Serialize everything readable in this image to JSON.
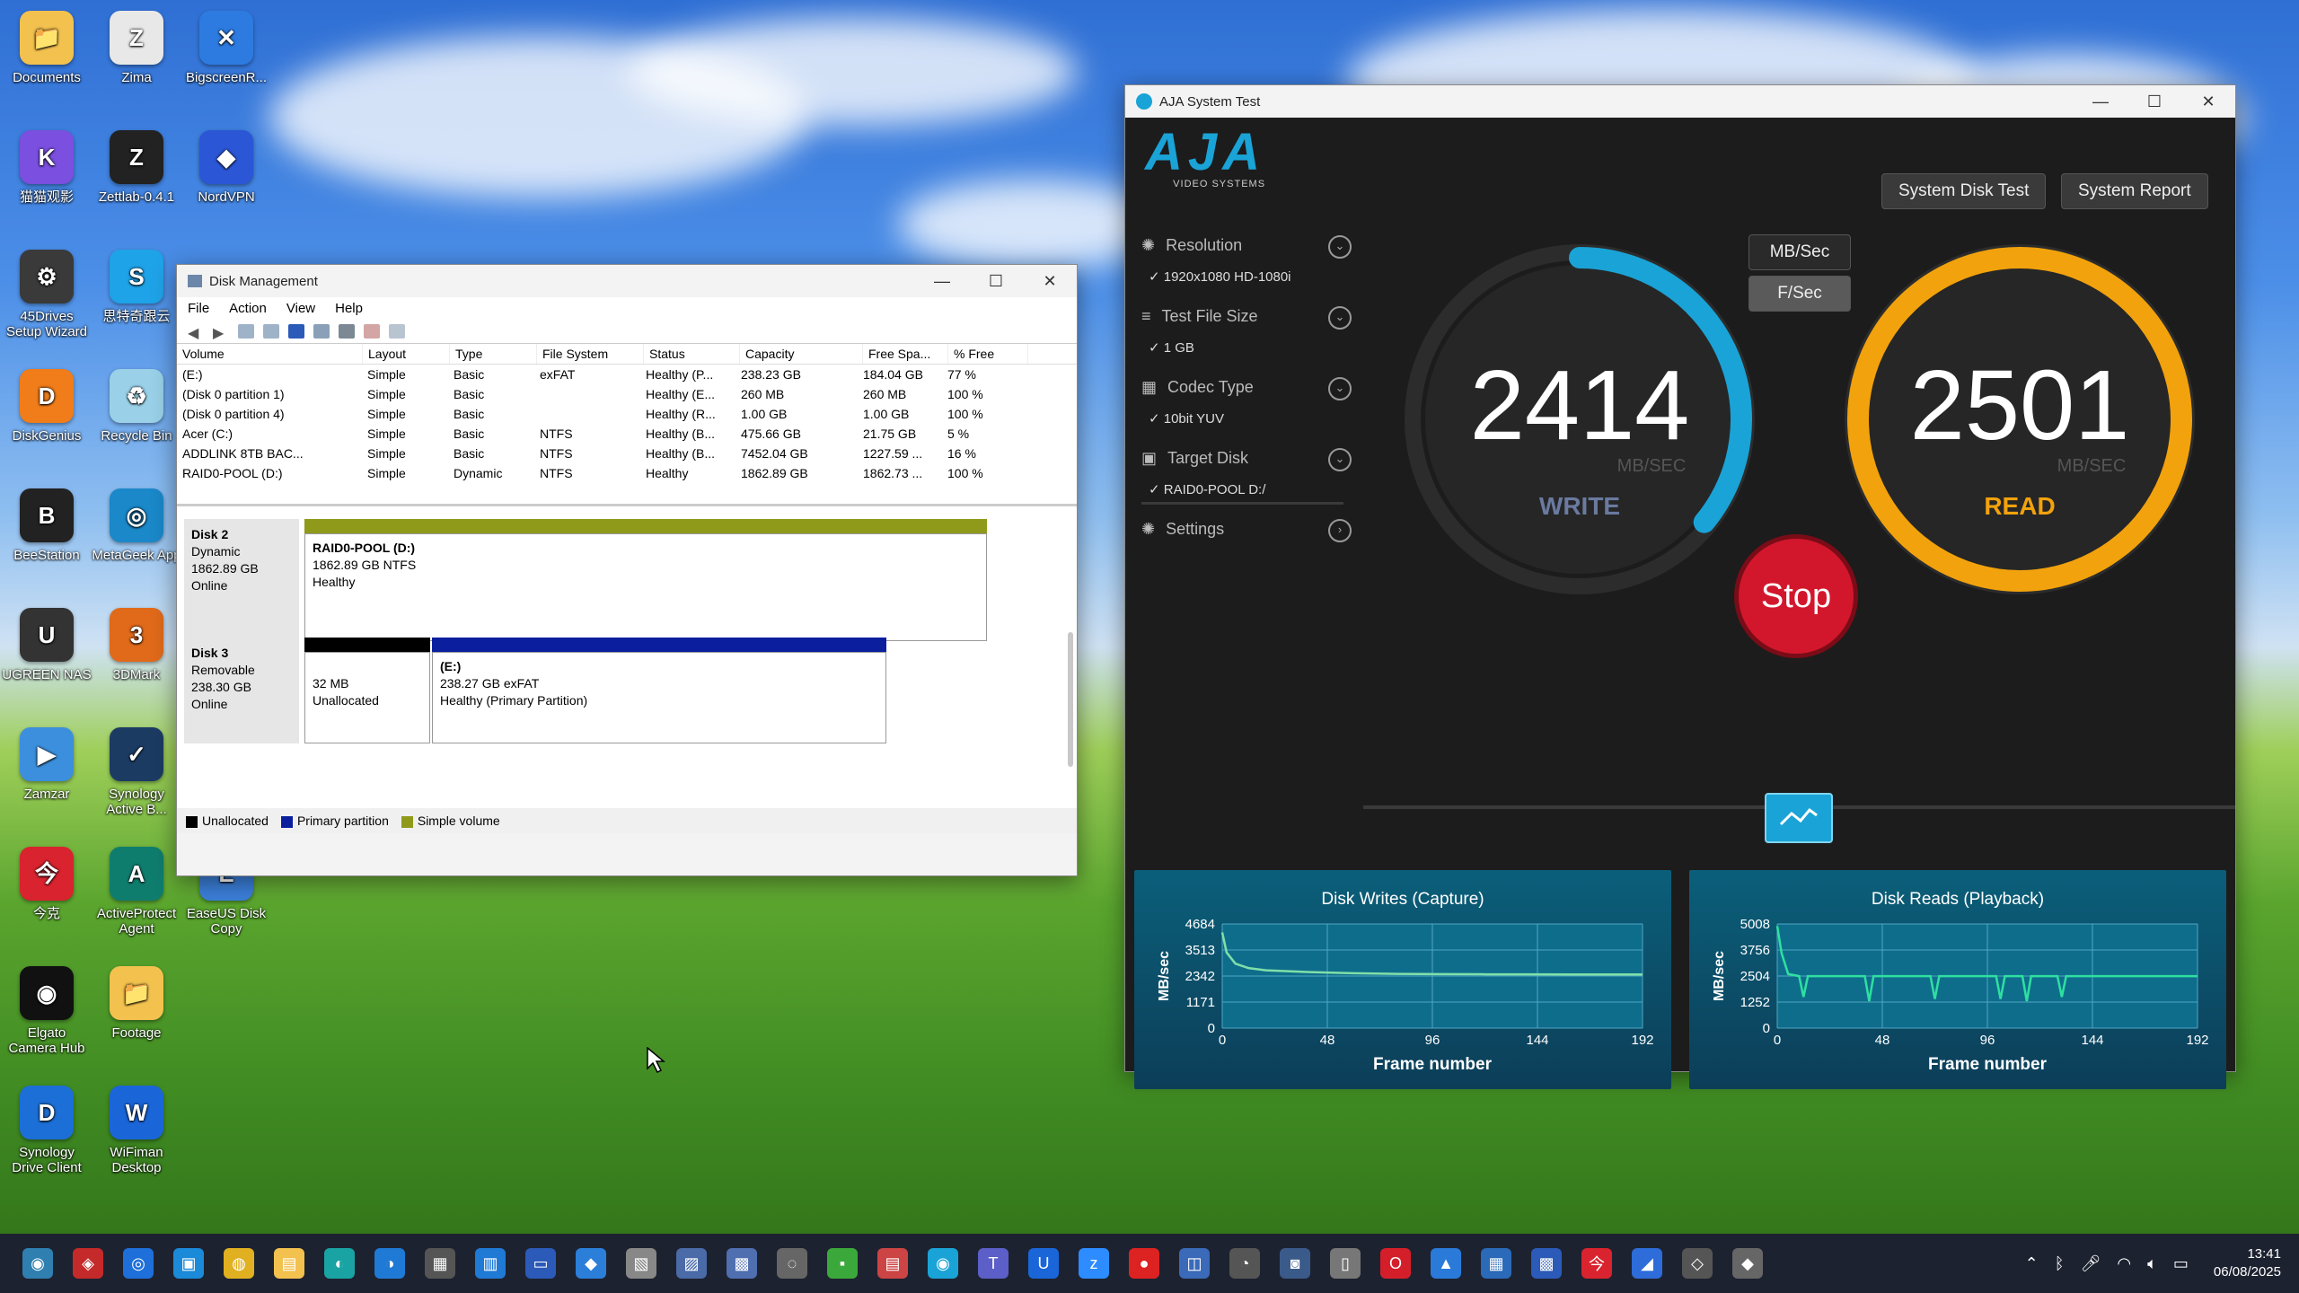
{
  "desktop": {
    "icons": [
      {
        "label": "Documents",
        "color": "#f2c14e",
        "glyph": "📁"
      },
      {
        "label": "Zima",
        "color": "#e8e8e8",
        "glyph": "Z"
      },
      {
        "label": "BigscreenR...",
        "color": "#2d7be0",
        "glyph": "✕"
      },
      {
        "label": "猫猫观影",
        "color": "#7b4fe0",
        "glyph": "K"
      },
      {
        "label": "Zettlab-0.4.1",
        "color": "#222",
        "glyph": "Z"
      },
      {
        "label": "NordVPN",
        "color": "#2b56d6",
        "glyph": "◆"
      },
      {
        "label": "45Drives Setup Wizard",
        "color": "#3a3a3a",
        "glyph": "⚙"
      },
      {
        "label": "思特奇跟云",
        "color": "#1fa3e8",
        "glyph": "S"
      },
      {
        "label": "DiskGenius",
        "color": "#f07c1a",
        "glyph": "D"
      },
      {
        "label": "Recycle Bin",
        "color": "#9ad1e8",
        "glyph": "♻"
      },
      {
        "label": "BeeStation",
        "color": "#222",
        "glyph": "B"
      },
      {
        "label": "MetaGeek App",
        "color": "#1a88c9",
        "glyph": "◎"
      },
      {
        "label": "UGREEN NAS",
        "color": "#333",
        "glyph": "U"
      },
      {
        "label": "3DMark",
        "color": "#e06a1a",
        "glyph": "3"
      },
      {
        "label": "Zamzar",
        "color": "#3c8fdc",
        "glyph": "▶"
      },
      {
        "label": "Synology Active B...",
        "color": "#1c3b63",
        "glyph": "✓"
      },
      {
        "label": "今克",
        "color": "#d9232e",
        "glyph": "今"
      },
      {
        "label": "ActiveProtect Agent",
        "color": "#0f7d6e",
        "glyph": "A"
      },
      {
        "label": "EaseUS Disk Copy",
        "color": "#3b7fd9",
        "glyph": "E"
      },
      {
        "label": "Elgato Camera Hub",
        "color": "#111",
        "glyph": "◉"
      },
      {
        "label": "Footage",
        "color": "#f2c14e",
        "glyph": "📁"
      },
      {
        "label": "Synology Drive Client",
        "color": "#1c6fd6",
        "glyph": "D"
      },
      {
        "label": "WiFiman Desktop",
        "color": "#1a66d9",
        "glyph": "W"
      }
    ]
  },
  "disk_mgmt": {
    "title": "Disk Management",
    "menu": [
      "File",
      "Action",
      "View",
      "Help"
    ],
    "columns": [
      "Volume",
      "Layout",
      "Type",
      "File System",
      "Status",
      "Capacity",
      "Free Spa...",
      "% Free"
    ],
    "rows": [
      [
        "(E:)",
        "Simple",
        "Basic",
        "exFAT",
        "Healthy (P...",
        "238.23 GB",
        "184.04 GB",
        "77 %"
      ],
      [
        "(Disk 0 partition 1)",
        "Simple",
        "Basic",
        "",
        "Healthy (E...",
        "260 MB",
        "260 MB",
        "100 %"
      ],
      [
        "(Disk 0 partition 4)",
        "Simple",
        "Basic",
        "",
        "Healthy (R...",
        "1.00 GB",
        "1.00 GB",
        "100 %"
      ],
      [
        "Acer (C:)",
        "Simple",
        "Basic",
        "NTFS",
        "Healthy (B...",
        "475.66 GB",
        "21.75 GB",
        "5 %"
      ],
      [
        "ADDLINK 8TB BAC...",
        "Simple",
        "Basic",
        "NTFS",
        "Healthy (B...",
        "7452.04 GB",
        "1227.59 ...",
        "16 %"
      ],
      [
        "RAID0-POOL (D:)",
        "Simple",
        "Dynamic",
        "NTFS",
        "Healthy",
        "1862.89 GB",
        "1862.73 ...",
        "100 %"
      ]
    ],
    "disk2": {
      "name": "Disk 2",
      "type": "Dynamic",
      "size": "1862.89 GB",
      "state": "Online",
      "part_name": "RAID0-POOL  (D:)",
      "part_size": "1862.89 GB NTFS",
      "part_status": "Healthy"
    },
    "disk3": {
      "name": "Disk 3",
      "type": "Removable",
      "size": "238.30 GB",
      "state": "Online",
      "unalloc_size": "32 MB",
      "unalloc_label": "Unallocated",
      "part_name": "(E:)",
      "part_size": "238.27 GB exFAT",
      "part_status": "Healthy (Primary Partition)"
    },
    "legend": [
      {
        "label": "Unallocated",
        "color": "#000000"
      },
      {
        "label": "Primary partition",
        "color": "#0b1f9e"
      },
      {
        "label": "Simple volume",
        "color": "#8f9a1a"
      }
    ]
  },
  "aja": {
    "title": "AJA System Test",
    "logo": "AJA",
    "logo_sub": "VIDEO SYSTEMS",
    "buttons": {
      "disk_test": "System Disk Test",
      "report": "System Report",
      "mbsec": "MB/Sec",
      "fsec": "F/Sec",
      "stop": "Stop"
    },
    "settings": [
      {
        "label": "Resolution",
        "value": "1920x1080 HD-1080i"
      },
      {
        "label": "Test File Size",
        "value": "1 GB"
      },
      {
        "label": "Codec Type",
        "value": "10bit YUV"
      },
      {
        "label": "Target Disk",
        "value": "RAID0-POOL D:/"
      },
      {
        "label": "Settings",
        "value": ""
      }
    ],
    "write": {
      "value": "2414",
      "unit": "MB/SEC",
      "label": "WRITE",
      "fraction": 0.36
    },
    "read": {
      "value": "2501",
      "unit": "MB/SEC",
      "label": "READ",
      "fraction": 1.0
    },
    "colors": {
      "write": "#1aa3d6",
      "read": "#f2a20c",
      "stop": "#d2172c"
    }
  },
  "chart_data": [
    {
      "type": "line",
      "title": "Disk Writes (Capture)",
      "xlabel": "Frame number",
      "ylabel": "MB/sec",
      "xlim": [
        0,
        192
      ],
      "ylim": [
        0,
        4684
      ],
      "xticks": [
        0,
        48,
        96,
        144,
        192
      ],
      "yticks": [
        0,
        1171,
        2342,
        3513,
        4684
      ],
      "series": [
        {
          "values": [
            {
              "x": 0,
              "y": 4300
            },
            {
              "x": 2,
              "y": 3400
            },
            {
              "x": 6,
              "y": 2900
            },
            {
              "x": 12,
              "y": 2700
            },
            {
              "x": 20,
              "y": 2600
            },
            {
              "x": 40,
              "y": 2520
            },
            {
              "x": 60,
              "y": 2470
            },
            {
              "x": 80,
              "y": 2440
            },
            {
              "x": 100,
              "y": 2430
            },
            {
              "x": 120,
              "y": 2420
            },
            {
              "x": 140,
              "y": 2420
            },
            {
              "x": 160,
              "y": 2415
            },
            {
              "x": 180,
              "y": 2414
            },
            {
              "x": 192,
              "y": 2414
            }
          ]
        }
      ]
    },
    {
      "type": "line",
      "title": "Disk Reads (Playback)",
      "xlabel": "Frame number",
      "ylabel": "MB/sec",
      "xlim": [
        0,
        192
      ],
      "ylim": [
        0,
        5008
      ],
      "xticks": [
        0,
        48,
        96,
        144,
        192
      ],
      "yticks": [
        0,
        1252,
        2504,
        3756,
        5008
      ],
      "series": [
        {
          "values": [
            {
              "x": 0,
              "y": 4900
            },
            {
              "x": 2,
              "y": 3600
            },
            {
              "x": 5,
              "y": 2600
            },
            {
              "x": 10,
              "y": 2500
            },
            {
              "x": 12,
              "y": 1500
            },
            {
              "x": 14,
              "y": 2500
            },
            {
              "x": 40,
              "y": 2500
            },
            {
              "x": 42,
              "y": 1300
            },
            {
              "x": 44,
              "y": 2500
            },
            {
              "x": 70,
              "y": 2500
            },
            {
              "x": 72,
              "y": 1400
            },
            {
              "x": 74,
              "y": 2500
            },
            {
              "x": 100,
              "y": 2500
            },
            {
              "x": 102,
              "y": 1400
            },
            {
              "x": 104,
              "y": 2500
            },
            {
              "x": 112,
              "y": 2500
            },
            {
              "x": 114,
              "y": 1300
            },
            {
              "x": 116,
              "y": 2500
            },
            {
              "x": 128,
              "y": 2500
            },
            {
              "x": 130,
              "y": 1500
            },
            {
              "x": 132,
              "y": 2500
            },
            {
              "x": 192,
              "y": 2501
            }
          ]
        }
      ]
    }
  ],
  "taskbar": {
    "time": "13:41",
    "date": "06/08/2025"
  }
}
